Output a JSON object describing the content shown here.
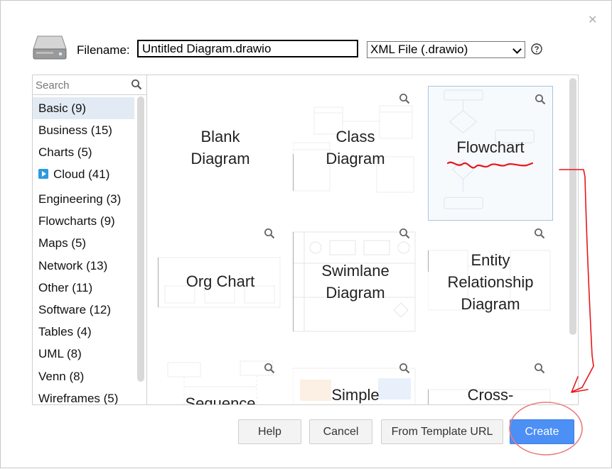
{
  "dialog": {
    "filename_label": "Filename:",
    "filename_value": "Untitled Diagram.drawio",
    "format_selected": "XML File (.drawio)"
  },
  "search": {
    "placeholder": "Search"
  },
  "categories": [
    {
      "label": "Basic (9)",
      "selected": true
    },
    {
      "label": "Business (15)"
    },
    {
      "label": "Charts (5)"
    },
    {
      "label": "Cloud (41)",
      "icon": "play-icon"
    },
    {
      "label": "Engineering (3)"
    },
    {
      "label": "Flowcharts (9)"
    },
    {
      "label": "Maps (5)"
    },
    {
      "label": "Network (13)"
    },
    {
      "label": "Other (11)"
    },
    {
      "label": "Software (12)"
    },
    {
      "label": "Tables (4)"
    },
    {
      "label": "UML (8)"
    },
    {
      "label": "Venn (8)"
    },
    {
      "label": "Wireframes (5)"
    }
  ],
  "templates": [
    {
      "lines": [
        "Blank",
        "Diagram"
      ]
    },
    {
      "lines": [
        "Class",
        "Diagram"
      ]
    },
    {
      "lines": [
        "Flowchart"
      ],
      "selected": true
    },
    {
      "lines": [
        "Org Chart"
      ]
    },
    {
      "lines": [
        "Swimlane",
        "Diagram"
      ]
    },
    {
      "lines": [
        "Entity",
        "Relationship",
        "Diagram"
      ]
    },
    {
      "lines": [
        "Sequence"
      ]
    },
    {
      "lines": [
        "Simple"
      ]
    },
    {
      "lines": [
        "Cross-"
      ]
    }
  ],
  "buttons": {
    "help": "Help",
    "cancel": "Cancel",
    "from_template_url": "From Template URL",
    "create": "Create"
  },
  "colors": {
    "accent": "#4c8ff5",
    "selection": "#e2ebf4",
    "annotation": "#e8161b"
  }
}
